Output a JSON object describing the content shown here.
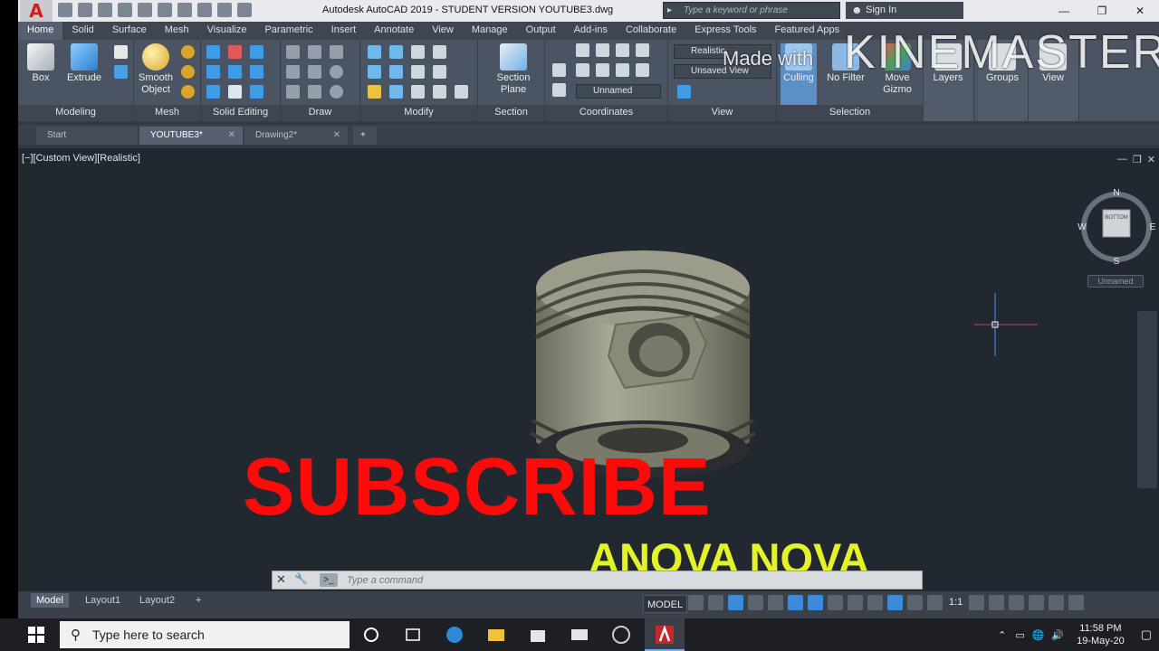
{
  "titlebar": {
    "title": "Autodesk AutoCAD 2019 - STUDENT VERSION    YOUTUBE3.dwg",
    "search_placeholder": "Type a keyword or phrase",
    "sign_in": "Sign In",
    "logo_letter": "A"
  },
  "ribbon_tabs": [
    "Home",
    "Solid",
    "Surface",
    "Mesh",
    "Visualize",
    "Parametric",
    "Insert",
    "Annotate",
    "View",
    "Manage",
    "Output",
    "Add-ins",
    "Collaborate",
    "Express Tools",
    "Featured Apps"
  ],
  "ribbon": {
    "groups": {
      "modeling": "Modeling",
      "mesh": "Mesh",
      "solid_editing": "Solid Editing",
      "draw": "Draw",
      "modify": "Modify",
      "section": "Section",
      "coordinates": "Coordinates",
      "view": "View",
      "selection": "Selection"
    },
    "buttons": {
      "box": "Box",
      "extrude": "Extrude",
      "smooth_object_1": "Smooth",
      "smooth_object_2": "Object",
      "section_plane_1": "Section",
      "section_plane_2": "Plane",
      "culling": "Culling",
      "no_filter": "No Filter",
      "move_gizmo_1": "Move",
      "move_gizmo_2": "Gizmo",
      "layers": "Layers",
      "groups": "Groups",
      "view": "View"
    },
    "combos": {
      "visual_style": "Realistic",
      "saved_view": "Unsaved View",
      "ucs": "Unnamed"
    }
  },
  "file_tabs": [
    {
      "label": "Start",
      "active": false
    },
    {
      "label": "YOUTUBE3*",
      "active": true
    },
    {
      "label": "Drawing2*",
      "active": false
    }
  ],
  "viewport": {
    "label": "[−][Custom View][Realistic]",
    "viewcube": {
      "face": "BOTTOM",
      "n": "N",
      "s": "S",
      "e": "E",
      "w": "W",
      "ucs_label": "Unnamed"
    }
  },
  "overlays": {
    "subscribe": "SUBSCRIBE",
    "channel": "ANOVA NOVA",
    "made_with": "Made with",
    "kinemaster": "KINEMASTER"
  },
  "command_line": {
    "placeholder": "Type a command"
  },
  "layout_tabs": [
    "Model",
    "Layout1",
    "Layout2"
  ],
  "statusbar": {
    "model": "MODEL",
    "scale": "1:1"
  },
  "taskbar": {
    "search_placeholder": "Type here to search",
    "time": "11:58 PM",
    "date": "19-May-20"
  }
}
